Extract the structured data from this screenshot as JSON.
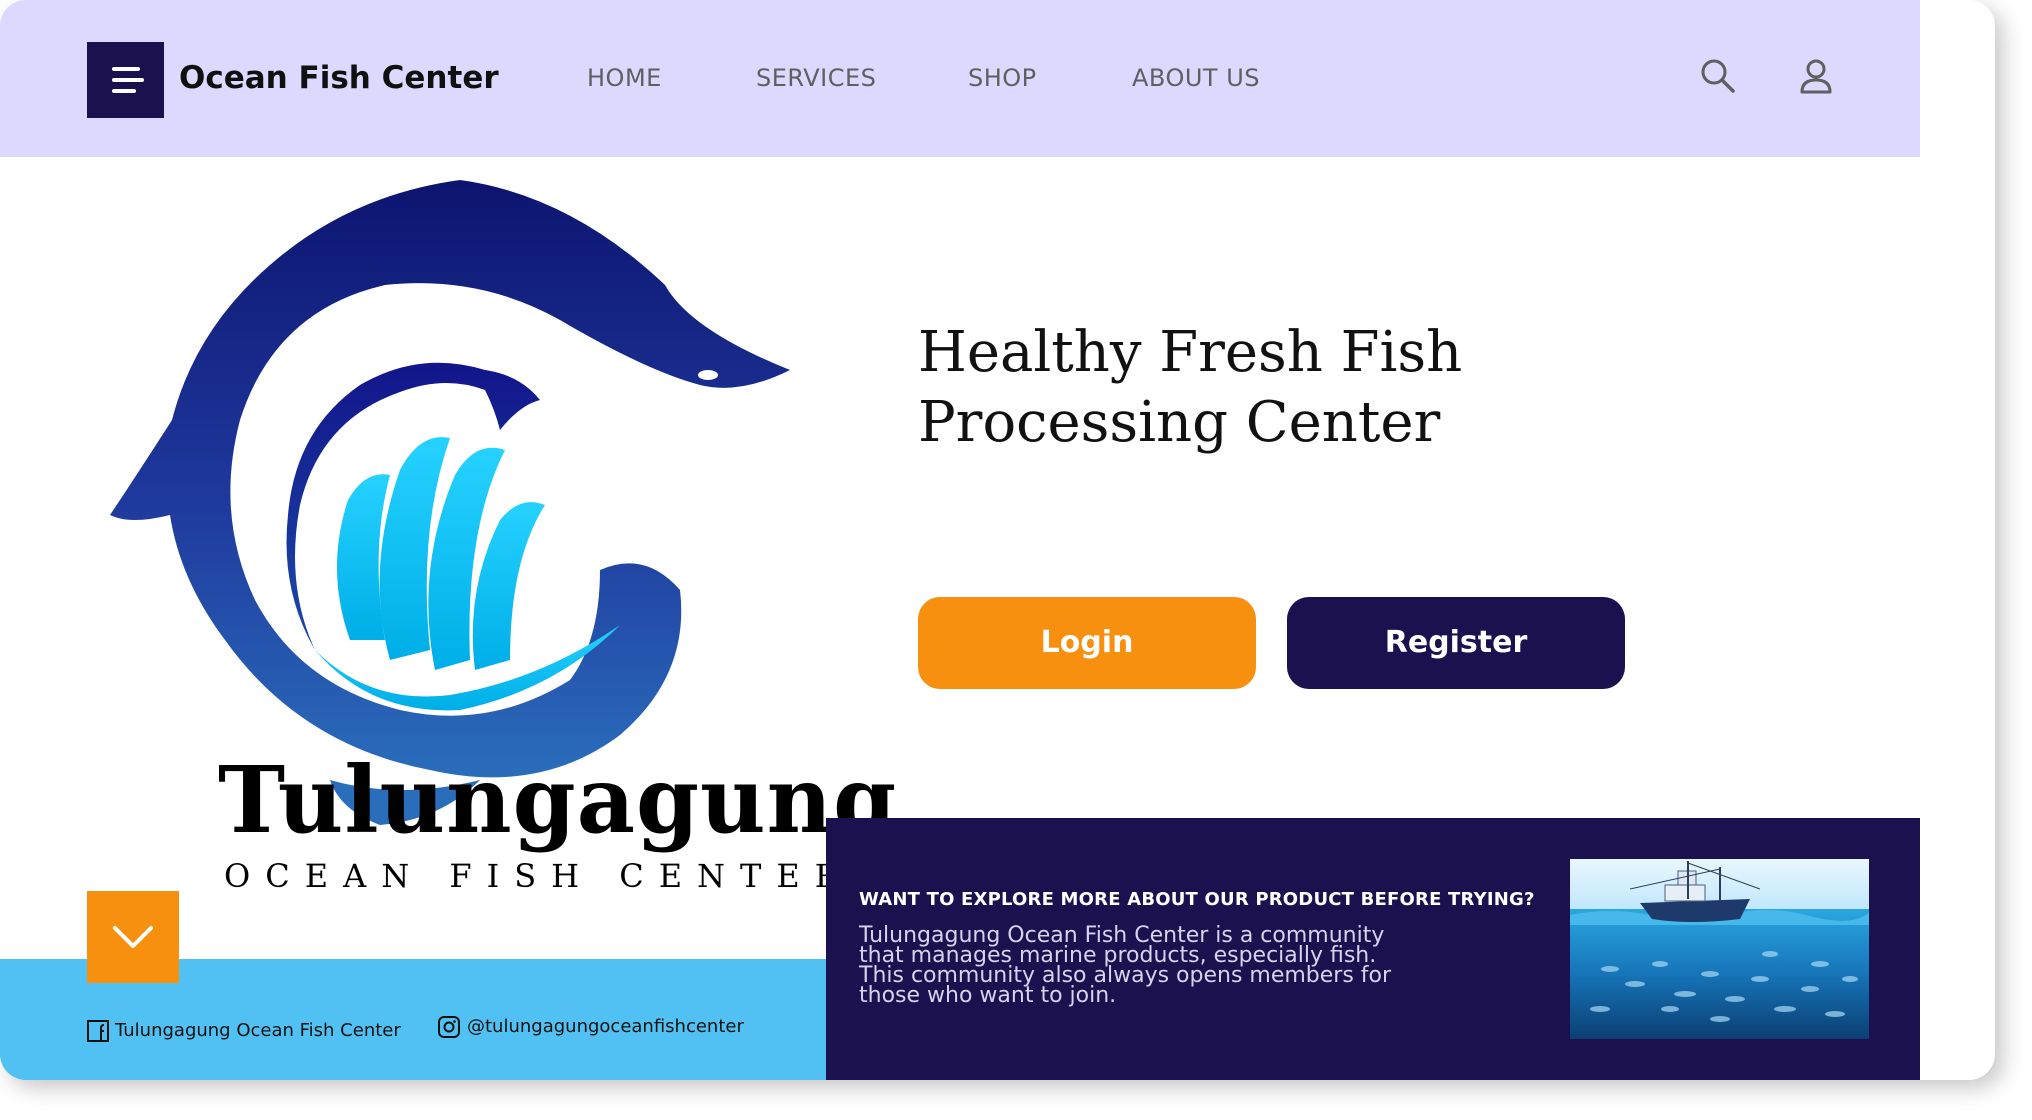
{
  "brand": {
    "name": "Ocean Fish Center"
  },
  "nav": {
    "items": [
      "HOME",
      "SERVICES",
      "SHOP",
      "ABOUT US"
    ]
  },
  "logo": {
    "title": "Tulungagung",
    "subtitle": "OCEAN FISH CENTER"
  },
  "hero": {
    "headline_line1": "Healthy Fresh Fish",
    "headline_line2": "Processing Center",
    "login_label": "Login",
    "register_label": "Register"
  },
  "footer": {
    "facebook": "Tulungagung Ocean Fish Center",
    "instagram": "@tulungagungoceanfishcenter"
  },
  "promo": {
    "title": "WANT TO EXPLORE MORE ABOUT OUR PRODUCT BEFORE TRYING?",
    "text_lines": [
      "Tulungagung Ocean Fish Center is a community",
      "that manages marine products, especially fish.",
      "This community also always opens members for",
      "those who want to join."
    ]
  },
  "colors": {
    "navy": "#1b114f",
    "orange": "#f7900e",
    "lavender": "#dcd8fe",
    "sky": "#51c0f2",
    "logo_dark": "#0e1673",
    "logo_cyan": "#12c6ff"
  },
  "icons": {
    "menu": "hamburger-menu-icon",
    "search": "search-icon",
    "user": "user-icon",
    "scroll": "chevron-down-icon",
    "facebook": "facebook-icon",
    "instagram": "instagram-icon"
  }
}
